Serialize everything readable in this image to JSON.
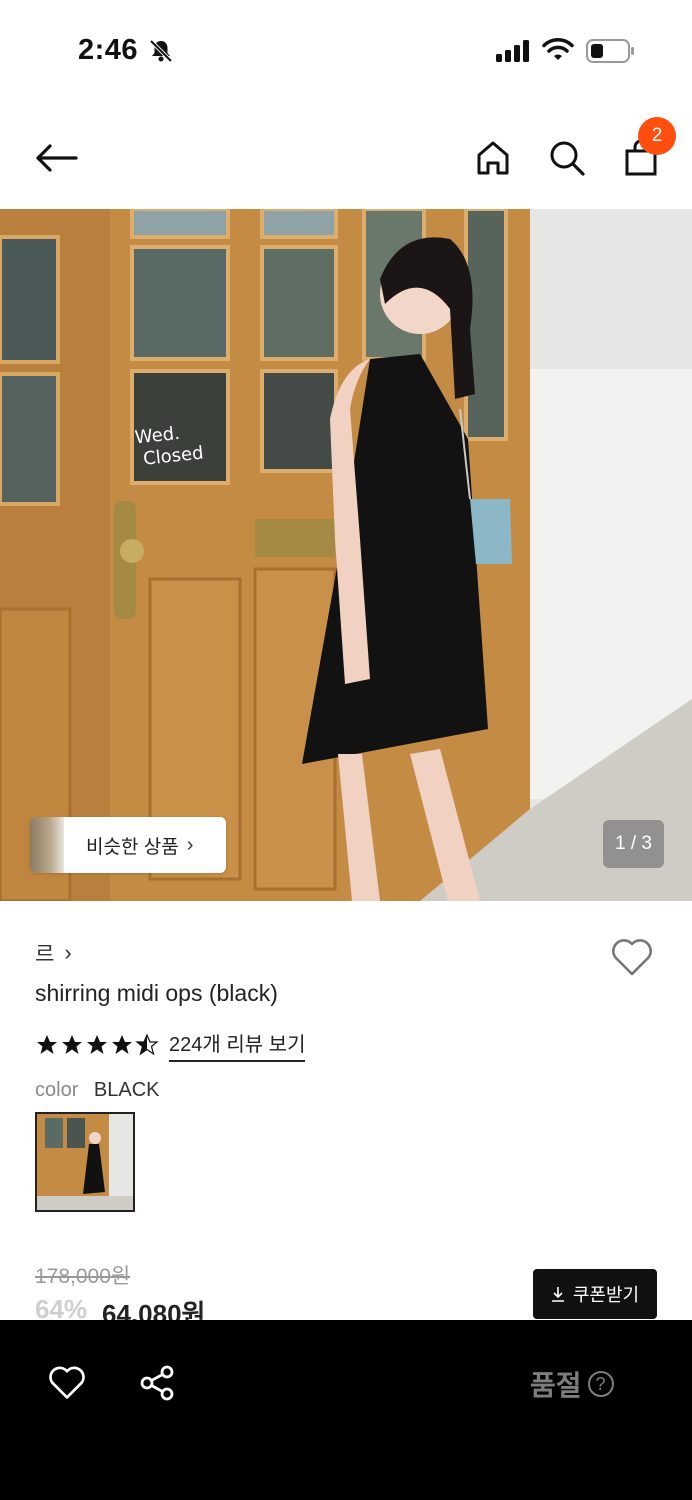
{
  "status_bar": {
    "time": "2:46"
  },
  "header": {
    "cart_count": "2"
  },
  "gallery": {
    "similar_label": "비슷한 상품",
    "similar_arrow": "›",
    "page_indicator": "1 / 3",
    "door_sign_line1": "Wed.",
    "door_sign_line2": "Closed"
  },
  "product": {
    "brand": "르",
    "brand_arrow": "›",
    "title": "shirring midi ops (black)",
    "rating": 4.5,
    "review_link": "224개 리뷰 보기",
    "color_label": "color",
    "color_value": "BLACK",
    "original_price": "178,000원",
    "discount": "64%",
    "sale_price": "64,080원",
    "coupon_label": "쿠폰받기"
  },
  "bottom_bar": {
    "soldout_label": "품절",
    "help_icon": "?"
  },
  "colors": {
    "accent_badge": "#ff4e0e",
    "bottom_bar_bg": "#000000"
  }
}
